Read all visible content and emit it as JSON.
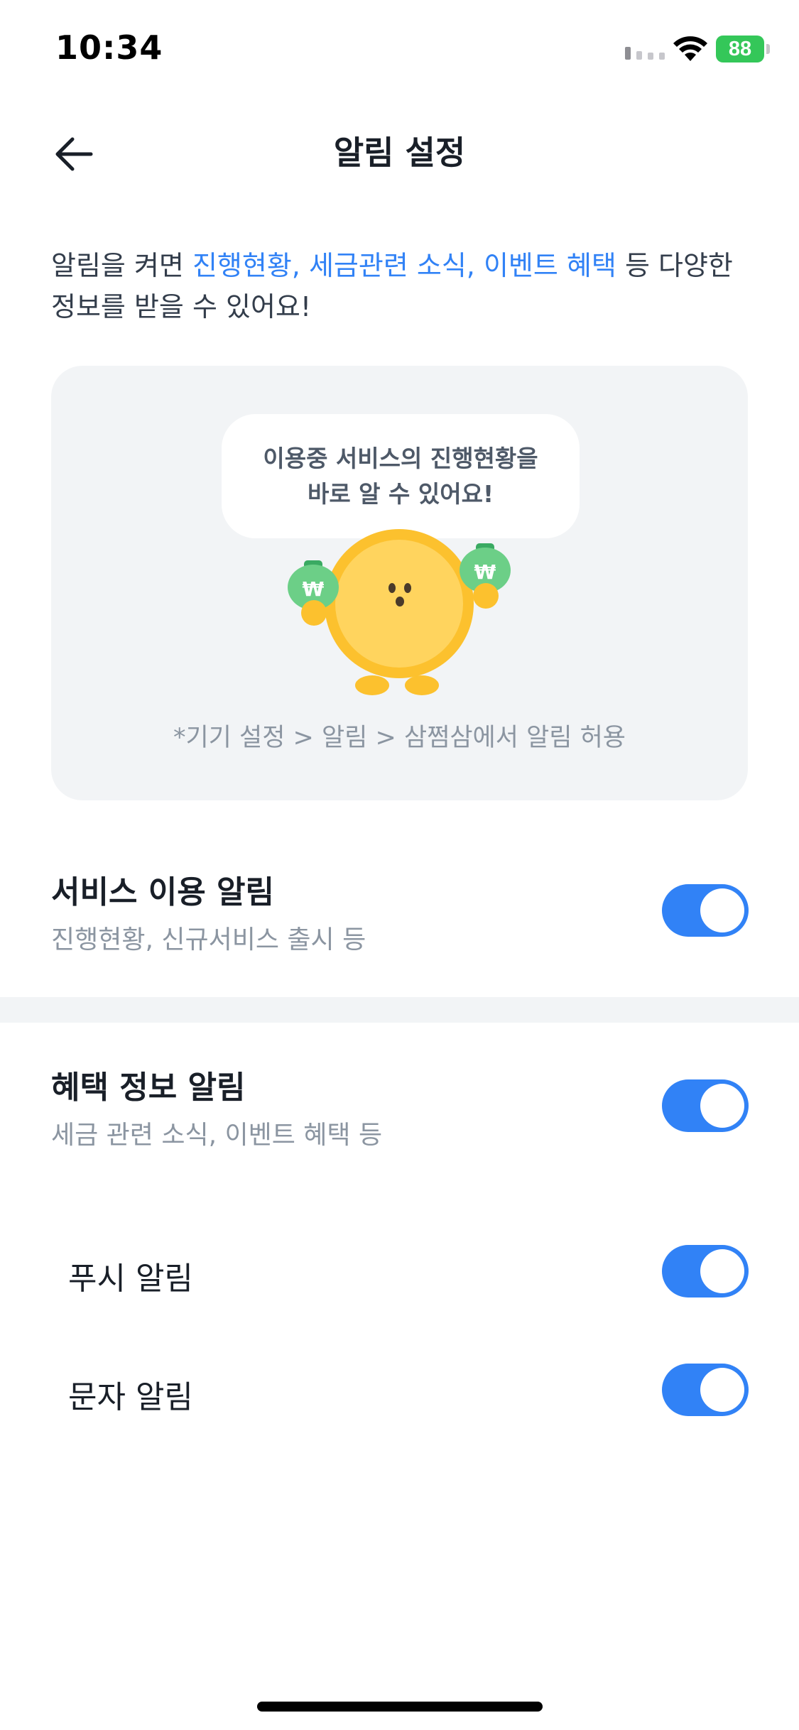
{
  "status_bar": {
    "time": "10:34",
    "battery": "88",
    "icons": [
      "signal-icon",
      "wifi-icon",
      "battery-charging-icon"
    ]
  },
  "nav": {
    "title": "알림 설정",
    "back_icon": "arrow-left-icon"
  },
  "intro": {
    "prefix": "알림을 켜면 ",
    "highlight": "진행현황, 세금관련 소식, 이벤트 혜택",
    "suffix": " 등 다양한 정보를 받을 수 있어요!"
  },
  "card": {
    "bubble_line1": "이용중 서비스의 진행현황을",
    "bubble_line2": "바로 알 수 있어요!",
    "mascot_icon": "coin-mascot-with-money-bags",
    "note": "*기기 설정 > 알림 > 삼쩜삼에서 알림 허용"
  },
  "settings": {
    "service": {
      "title": "서비스 이용 알림",
      "subtitle": "진행현황, 신규서비스 출시 등",
      "enabled": true
    },
    "benefit": {
      "title": "혜택 정보 알림",
      "subtitle": "세금 관련 소식, 이벤트 혜택 등",
      "enabled": true
    },
    "push": {
      "label": "푸시 알림",
      "enabled": true
    },
    "sms": {
      "label": "문자 알림",
      "enabled": true
    }
  },
  "colors": {
    "accent": "#3182f6",
    "card_bg": "#f2f4f6",
    "mascot": "#fcc12e",
    "money_bag": "#6ccf87",
    "battery": "#34c759"
  }
}
